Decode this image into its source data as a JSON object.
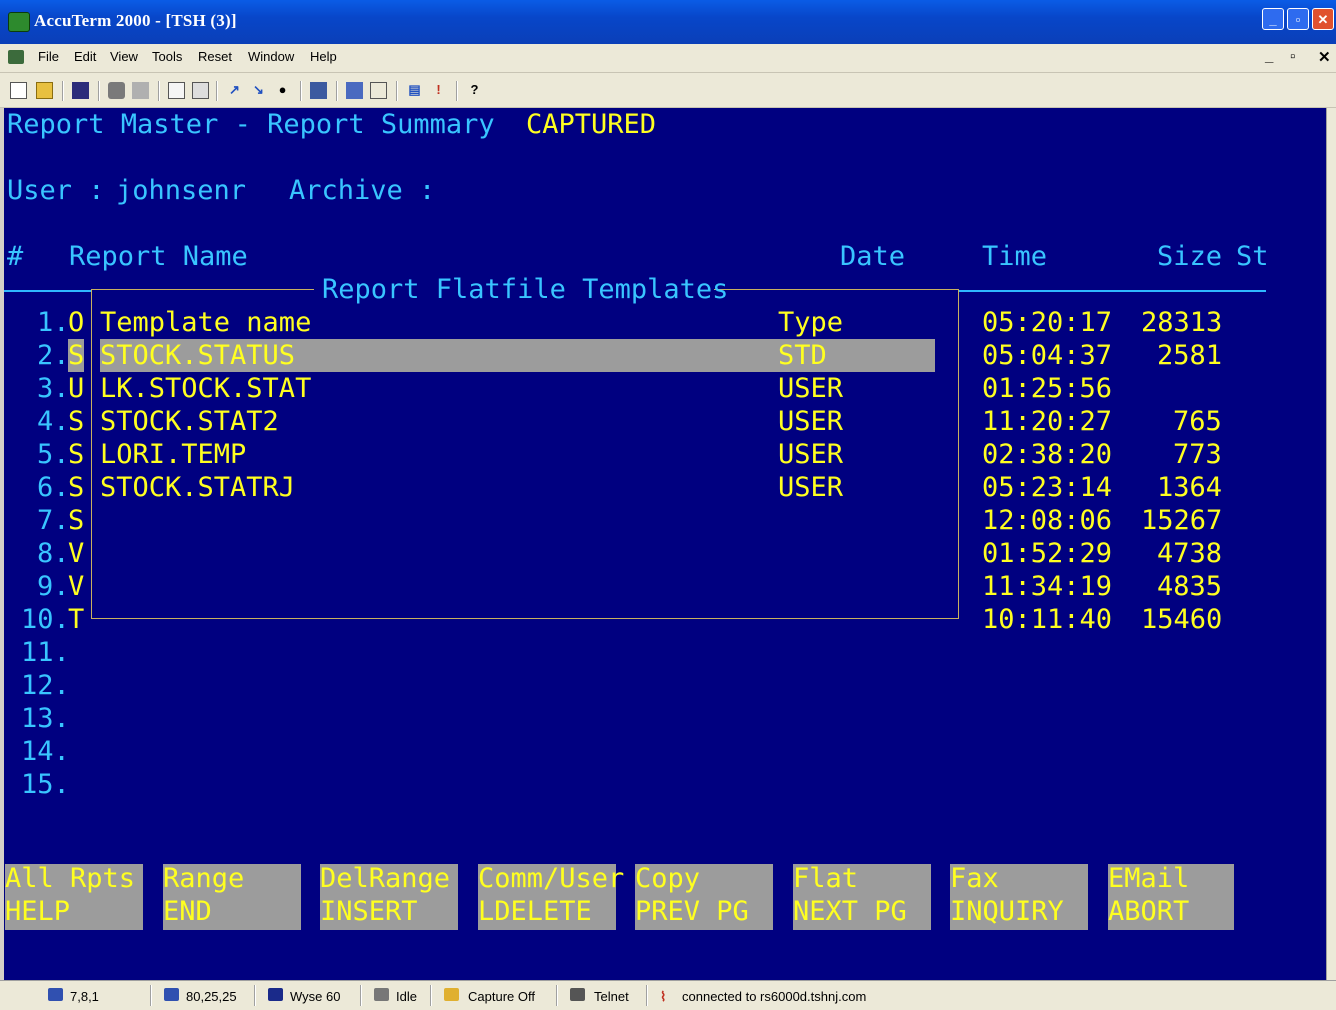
{
  "window": {
    "title": "AccuTerm 2000 - [TSH (3)]"
  },
  "menu": {
    "items": [
      "File",
      "Edit",
      "View",
      "Tools",
      "Reset",
      "Window",
      "Help"
    ]
  },
  "terminal": {
    "header": {
      "title": "Report Master - Report Summary",
      "status": "CAPTURED"
    },
    "user_line": {
      "user_label": "User :",
      "user": "johnsenr",
      "archive_label": "Archive :"
    },
    "columns": {
      "num": "#",
      "name": "Report Name",
      "date": "Date",
      "time": "Time",
      "size": "Size",
      "st": "St"
    },
    "rows": [
      {
        "num": "1.",
        "letter": "O",
        "time": "05:20:17",
        "size": "28313"
      },
      {
        "num": "2.",
        "letter": "S",
        "time": "05:04:37",
        "size": "2581"
      },
      {
        "num": "3.",
        "letter": "U",
        "time": "01:25:56",
        "size": ""
      },
      {
        "num": "4.",
        "letter": "S",
        "time": "11:20:27",
        "size": "765"
      },
      {
        "num": "5.",
        "letter": "S",
        "time": "02:38:20",
        "size": "773"
      },
      {
        "num": "6.",
        "letter": "S",
        "time": "05:23:14",
        "size": "1364"
      },
      {
        "num": "7.",
        "letter": "S",
        "time": "12:08:06",
        "size": "15267"
      },
      {
        "num": "8.",
        "letter": "V",
        "time": "01:52:29",
        "size": "4738"
      },
      {
        "num": "9.",
        "letter": "V",
        "time": "11:34:19",
        "size": "4835"
      },
      {
        "num": "10.",
        "letter": "T",
        "time": "10:11:40",
        "size": "15460"
      },
      {
        "num": "11.",
        "letter": "",
        "time": "",
        "size": ""
      },
      {
        "num": "12.",
        "letter": "",
        "time": "",
        "size": ""
      },
      {
        "num": "13.",
        "letter": "",
        "time": "",
        "size": ""
      },
      {
        "num": "14.",
        "letter": "",
        "time": "",
        "size": ""
      },
      {
        "num": "15.",
        "letter": "",
        "time": "",
        "size": ""
      }
    ],
    "popup": {
      "title": "Report Flatfile Templates",
      "col_name": "Template name",
      "col_type": "Type",
      "templates": [
        {
          "name": "STOCK.STATUS",
          "type": "STD",
          "selected": true
        },
        {
          "name": "LK.STOCK.STAT",
          "type": "USER"
        },
        {
          "name": "STOCK.STAT2",
          "type": "USER"
        },
        {
          "name": "LORI.TEMP",
          "type": "USER"
        },
        {
          "name": "STOCK.STATRJ",
          "type": "USER"
        }
      ]
    },
    "function_keys": [
      {
        "line1": "All Rpts",
        "line2": "HELP"
      },
      {
        "line1": "Range",
        "line2": "END"
      },
      {
        "line1": "DelRange",
        "line2": "INSERT"
      },
      {
        "line1": "Comm/User",
        "line2": "LDELETE"
      },
      {
        "line1": "Copy",
        "line2": "PREV PG"
      },
      {
        "line1": "Flat",
        "line2": "NEXT PG"
      },
      {
        "line1": "Fax",
        "line2": "INQUIRY"
      },
      {
        "line1": "EMail",
        "line2": "ABORT"
      }
    ]
  },
  "status_bar": {
    "cursor": "7,8,1",
    "screen": "80,25,25",
    "emulation": "Wyse 60",
    "printer": "Idle",
    "capture": "Capture Off",
    "protocol": "Telnet",
    "connection": "connected to rs6000d.tshnj.com"
  },
  "colors": {
    "background": "#000080",
    "cyan": "#39c5ff",
    "yellow": "#ffff20",
    "highlight": "#9c9c9c"
  }
}
